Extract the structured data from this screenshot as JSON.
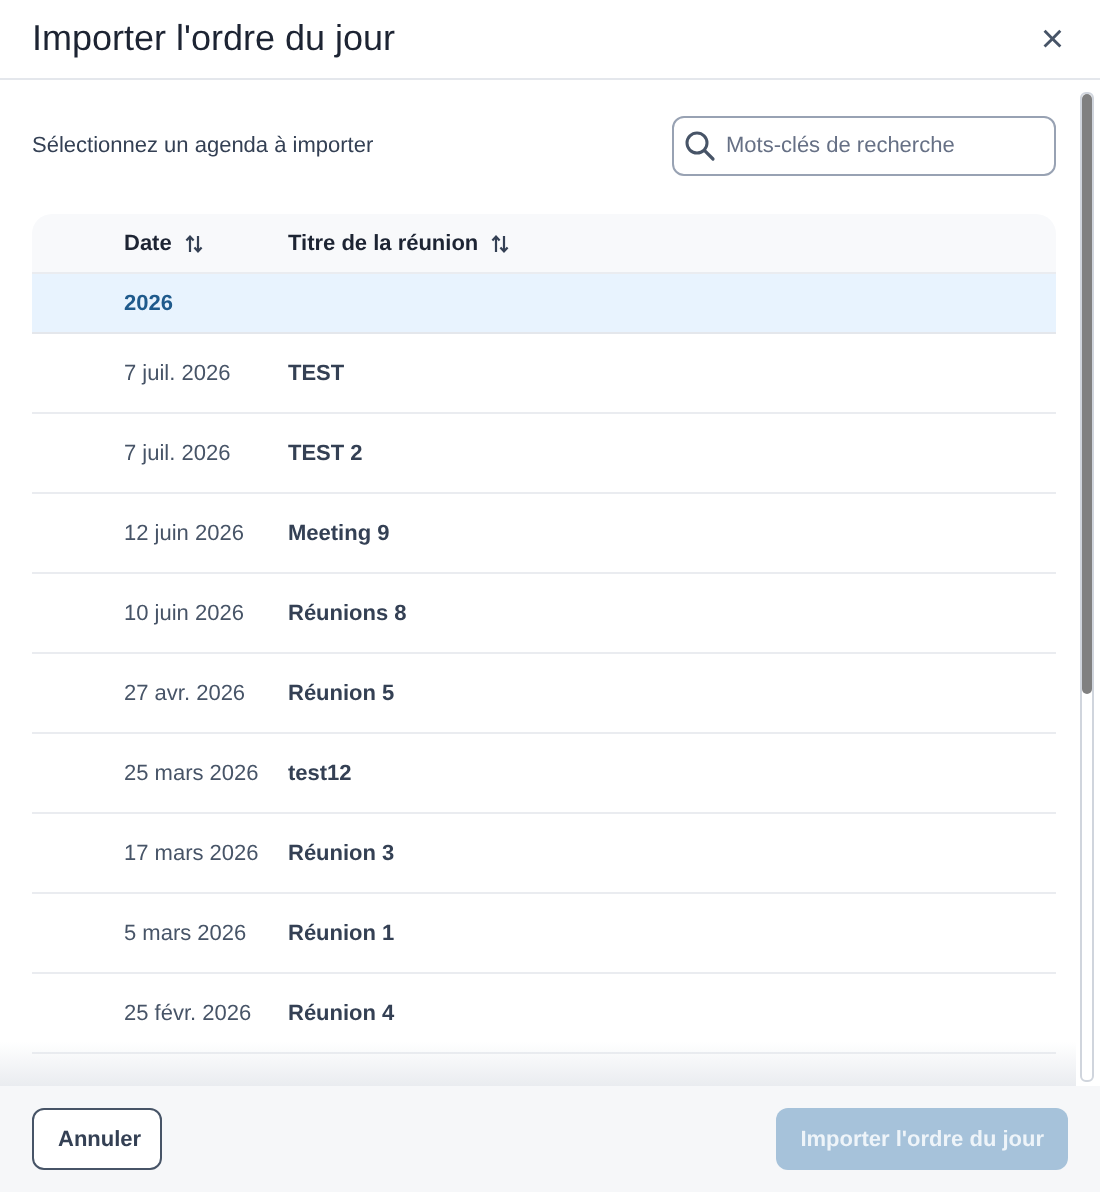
{
  "dialog": {
    "title": "Importer l'ordre du jour",
    "close": "×"
  },
  "prompt": "Sélectionnez un agenda à importer",
  "search": {
    "placeholder": "Mots-clés de recherche"
  },
  "table": {
    "columns": [
      {
        "label": "Date"
      },
      {
        "label": "Titre de la réunion"
      }
    ],
    "group": "2026",
    "rows": [
      {
        "date": "7 juil. 2026",
        "title": "TEST"
      },
      {
        "date": "7 juil. 2026",
        "title": "TEST 2"
      },
      {
        "date": "12 juin 2026",
        "title": "Meeting 9"
      },
      {
        "date": "10 juin 2026",
        "title": "Réunions 8"
      },
      {
        "date": "27 avr. 2026",
        "title": "Réunion 5"
      },
      {
        "date": "25 mars 2026",
        "title": "test12"
      },
      {
        "date": "17 mars 2026",
        "title": "Réunion 3"
      },
      {
        "date": "5 mars 2026",
        "title": "Réunion 1"
      },
      {
        "date": "25 févr. 2026",
        "title": "Réunion 4"
      }
    ]
  },
  "buttons": [
    {
      "label": "Annuler",
      "kind": "secondary",
      "disabled": false
    },
    {
      "label": "Importer l'ordre du jour",
      "kind": "primary",
      "disabled": true
    }
  ]
}
